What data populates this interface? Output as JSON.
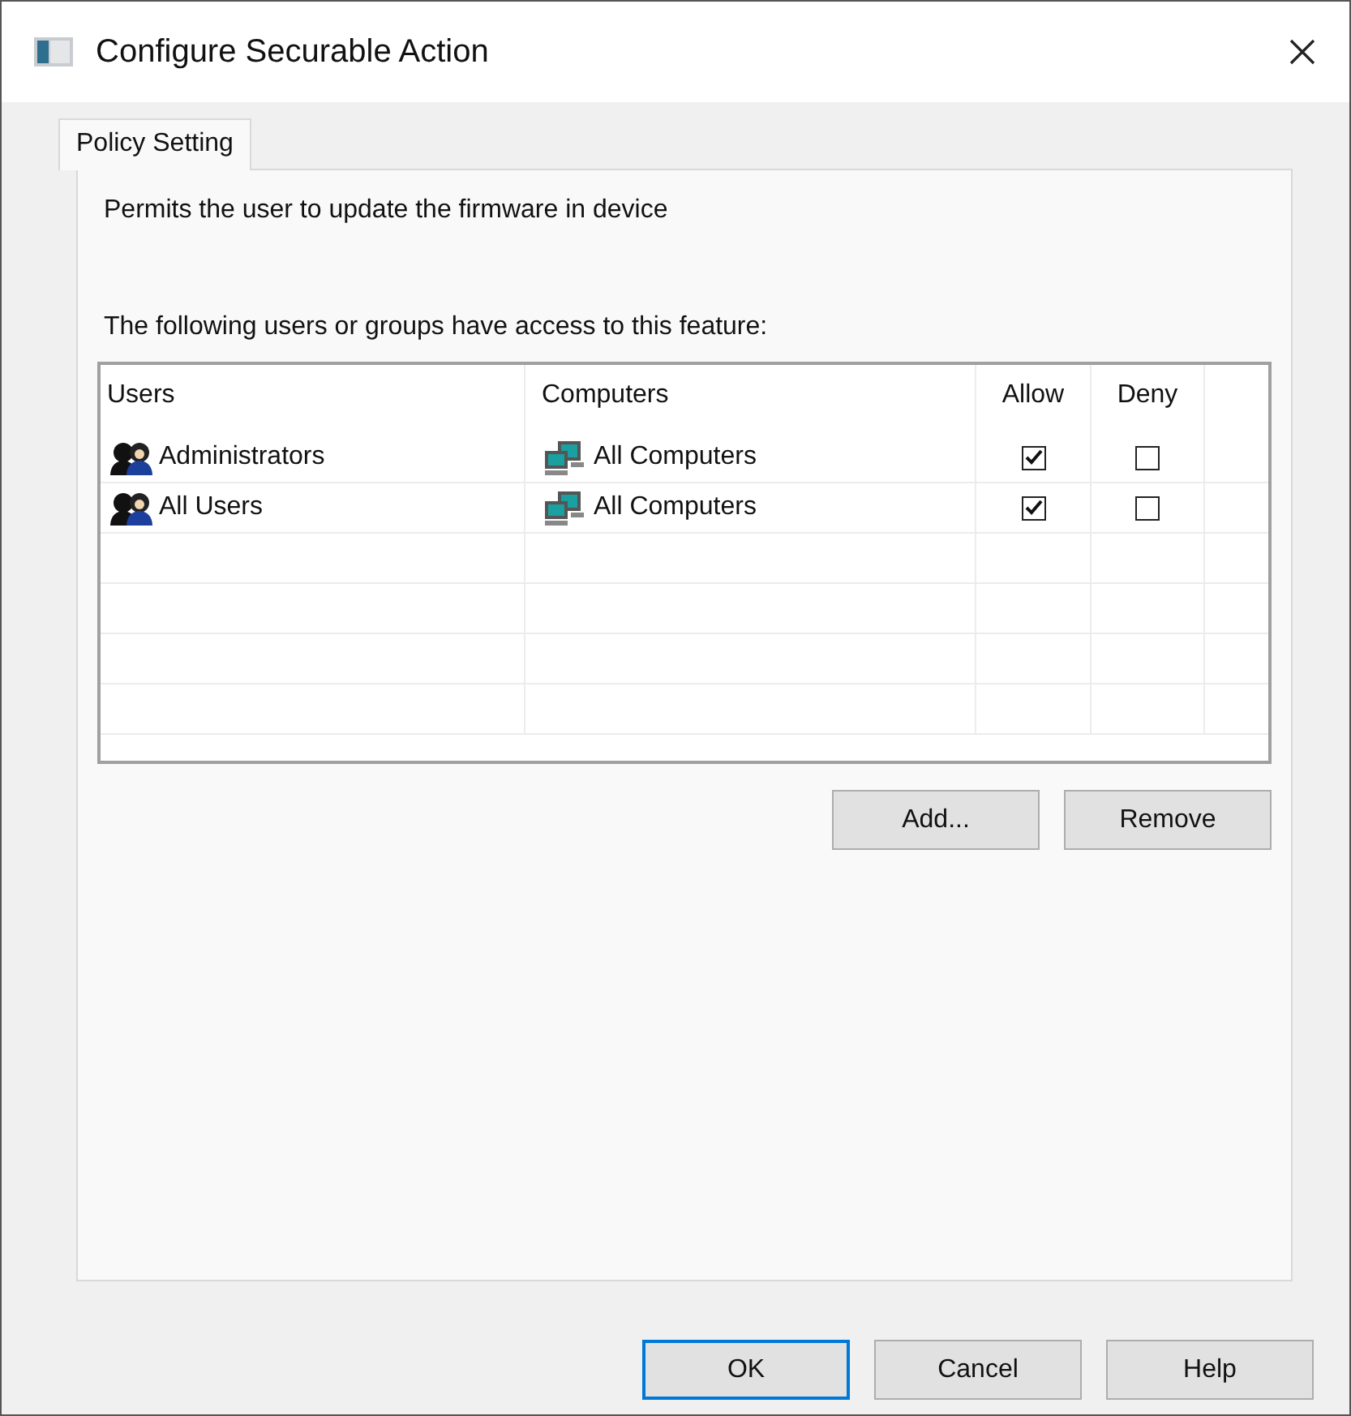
{
  "window": {
    "title": "Configure Securable Action"
  },
  "tabs": [
    {
      "label": "Policy Setting",
      "selected": true
    }
  ],
  "description": "Permits the user to update the firmware in device",
  "access_label": "The following users or groups have access to this feature:",
  "table": {
    "columns": [
      "Users",
      "Computers",
      "Allow",
      "Deny"
    ],
    "rows": [
      {
        "user": "Administrators",
        "computer": "All Computers",
        "allow": true,
        "deny": false
      },
      {
        "user": "All Users",
        "computer": "All Computers",
        "allow": true,
        "deny": false
      }
    ]
  },
  "table_buttons": [
    "Add...",
    "Remove"
  ],
  "buttons": [
    {
      "label": "OK",
      "selected": true
    },
    {
      "label": "Cancel",
      "selected": false
    },
    {
      "label": "Help",
      "selected": false
    }
  ]
}
